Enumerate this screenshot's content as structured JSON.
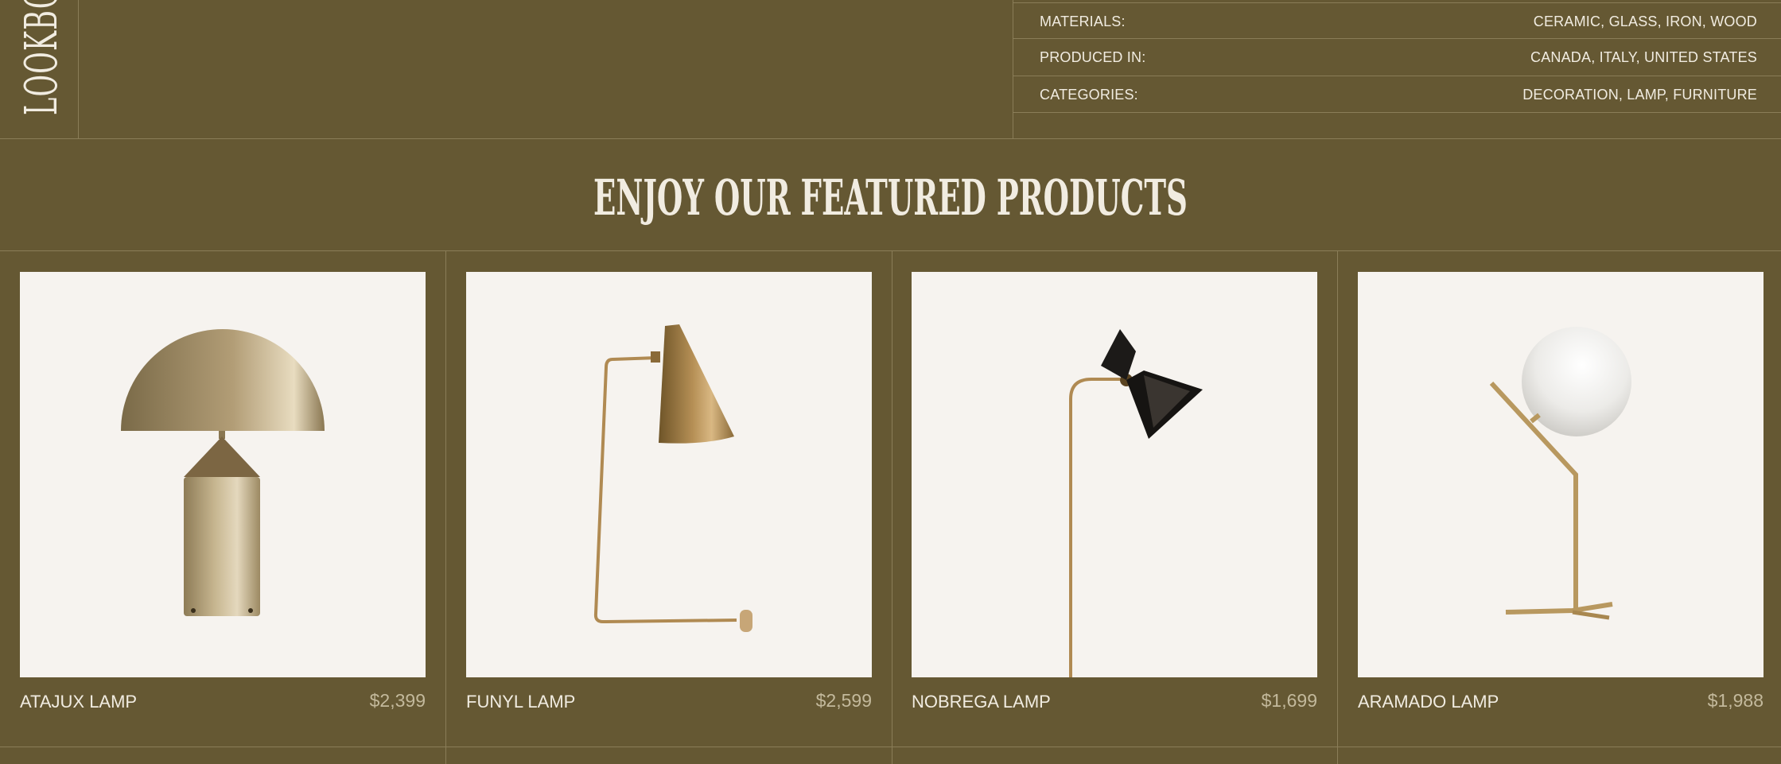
{
  "brand": {
    "vertical_label": "LOOKBOOK"
  },
  "specs": [
    {
      "label": "MATERIALS:",
      "value": "CERAMIC, GLASS, IRON, WOOD"
    },
    {
      "label": "PRODUCED IN:",
      "value": "CANADA, ITALY, UNITED STATES"
    },
    {
      "label": "CATEGORIES:",
      "value": "DECORATION, LAMP, FURNITURE"
    }
  ],
  "featured": {
    "title": "ENJOY OUR FEATURED PRODUCTS"
  },
  "products": [
    {
      "name": "ATAJUX LAMP",
      "price": "$2,399",
      "icon": "mushroom-table-lamp-image"
    },
    {
      "name": "FUNYL LAMP",
      "price": "$2,599",
      "icon": "cone-desk-lamp-image"
    },
    {
      "name": "NOBREGA LAMP",
      "price": "$1,699",
      "icon": "bowtie-floor-lamp-image"
    },
    {
      "name": "ARAMADO LAMP",
      "price": "$1,988",
      "icon": "globe-table-lamp-image"
    }
  ],
  "colors": {
    "background": "#655833",
    "card": "#f6f3ef",
    "text": "#f1ece1",
    "price": "#c3b99c",
    "line": "#8a7d58"
  }
}
